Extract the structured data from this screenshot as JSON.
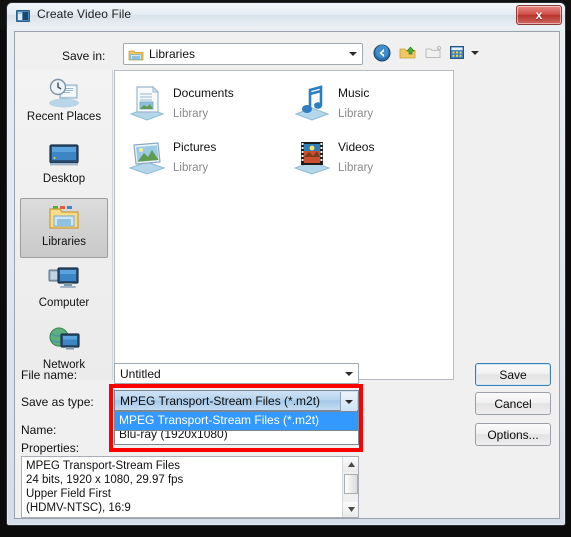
{
  "window": {
    "title": "Create Video File",
    "app_icon": "video-file-icon",
    "close_label": "x"
  },
  "toolbar": {
    "save_in_label": "Save in:",
    "location": "Libraries",
    "location_icon": "libraries-folder-icon",
    "buttons": [
      {
        "name": "back-button",
        "icon": "back-arrow-icon"
      },
      {
        "name": "up-one-level-button",
        "icon": "up-folder-icon"
      },
      {
        "name": "new-folder-button",
        "icon": "new-folder-icon"
      },
      {
        "name": "views-button",
        "icon": "views-icon"
      }
    ]
  },
  "places": [
    {
      "label": "Recent Places",
      "icon": "recent-places-icon",
      "selected": false
    },
    {
      "label": "Desktop",
      "icon": "desktop-icon",
      "selected": false
    },
    {
      "label": "Libraries",
      "icon": "libraries-icon",
      "selected": true
    },
    {
      "label": "Computer",
      "icon": "computer-icon",
      "selected": false
    },
    {
      "label": "Network",
      "icon": "network-icon",
      "selected": false
    }
  ],
  "file_list": [
    {
      "name": "Documents",
      "sub": "Library",
      "icon": "documents-library-icon"
    },
    {
      "name": "Music",
      "sub": "Library",
      "icon": "music-library-icon"
    },
    {
      "name": "Pictures",
      "sub": "Library",
      "icon": "pictures-library-icon"
    },
    {
      "name": "Videos",
      "sub": "Library",
      "icon": "videos-library-icon"
    }
  ],
  "form": {
    "file_name_label": "File name:",
    "file_name_value": "Untitled",
    "save_as_type_label": "Save as type:",
    "save_as_type_value": "MPEG Transport-Stream Files (*.m2t)",
    "name_label": "Name:",
    "dropdown_options": [
      "MPEG Transport-Stream Files (*.m2t)"
    ],
    "dropdown_selected_index": 0,
    "obscured_option": "Blu-ray (1920x1080)"
  },
  "buttons": {
    "save": "Save",
    "cancel": "Cancel",
    "options": "Options..."
  },
  "properties": {
    "label": "Properties:",
    "text": "MPEG Transport-Stream Files\n24 bits, 1920 x 1080, 29.97 fps\nUpper Field First\n(HDMV-NTSC), 16:9"
  },
  "colors": {
    "accent": "#3399ff",
    "annotation": "#ff0000",
    "close_button": "#b8342e",
    "dialog_bg": "#f0f0f0"
  }
}
